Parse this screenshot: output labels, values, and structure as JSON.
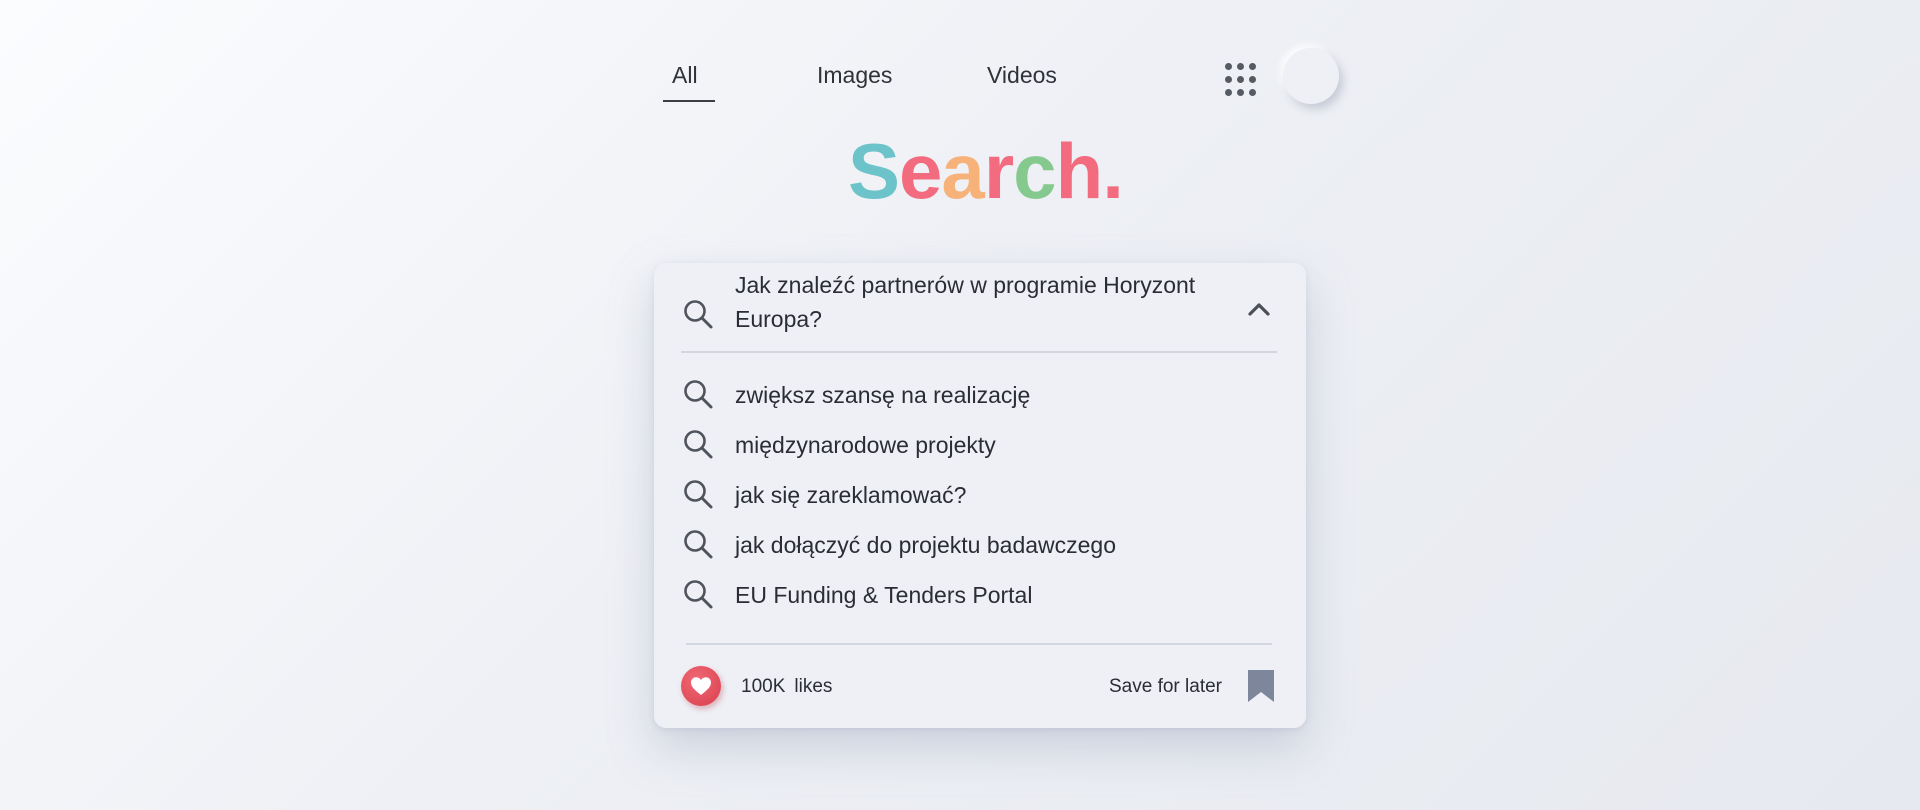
{
  "nav": {
    "tabs": [
      {
        "label": "All",
        "active": true
      },
      {
        "label": "Images",
        "active": false
      },
      {
        "label": "Videos",
        "active": false
      }
    ],
    "apps_icon": "grid-dots-icon",
    "avatar_icon": "avatar"
  },
  "logo": {
    "letters": [
      {
        "char": "S",
        "color": "#6cc3c9"
      },
      {
        "char": "e",
        "color": "#f26b7e"
      },
      {
        "char": "a",
        "color": "#f7b27a"
      },
      {
        "char": "r",
        "color": "#f26b7e"
      },
      {
        "char": "c",
        "color": "#86c98f"
      },
      {
        "char": "h",
        "color": "#f26b7e"
      },
      {
        "char": ".",
        "color": "#f26b7e"
      }
    ]
  },
  "search": {
    "query": "Jak znaleźć partnerów w programie Horyzont Europa?",
    "icon": "search-icon",
    "collapse_icon": "chevron-up-icon",
    "suggestions": [
      "zwiększ szansę na realizację",
      "międzynarodowe projekty",
      "jak się zareklamować?",
      "jak dołączyć do projektu badawczego",
      "EU Funding & Tenders Portal"
    ]
  },
  "footer": {
    "likes_count": "100K",
    "likes_unit": "likes",
    "like_icon": "heart-icon",
    "like_color": "#e04a58",
    "save_label": "Save for later",
    "save_icon": "bookmark-icon",
    "bookmark_color": "#7d869a"
  }
}
